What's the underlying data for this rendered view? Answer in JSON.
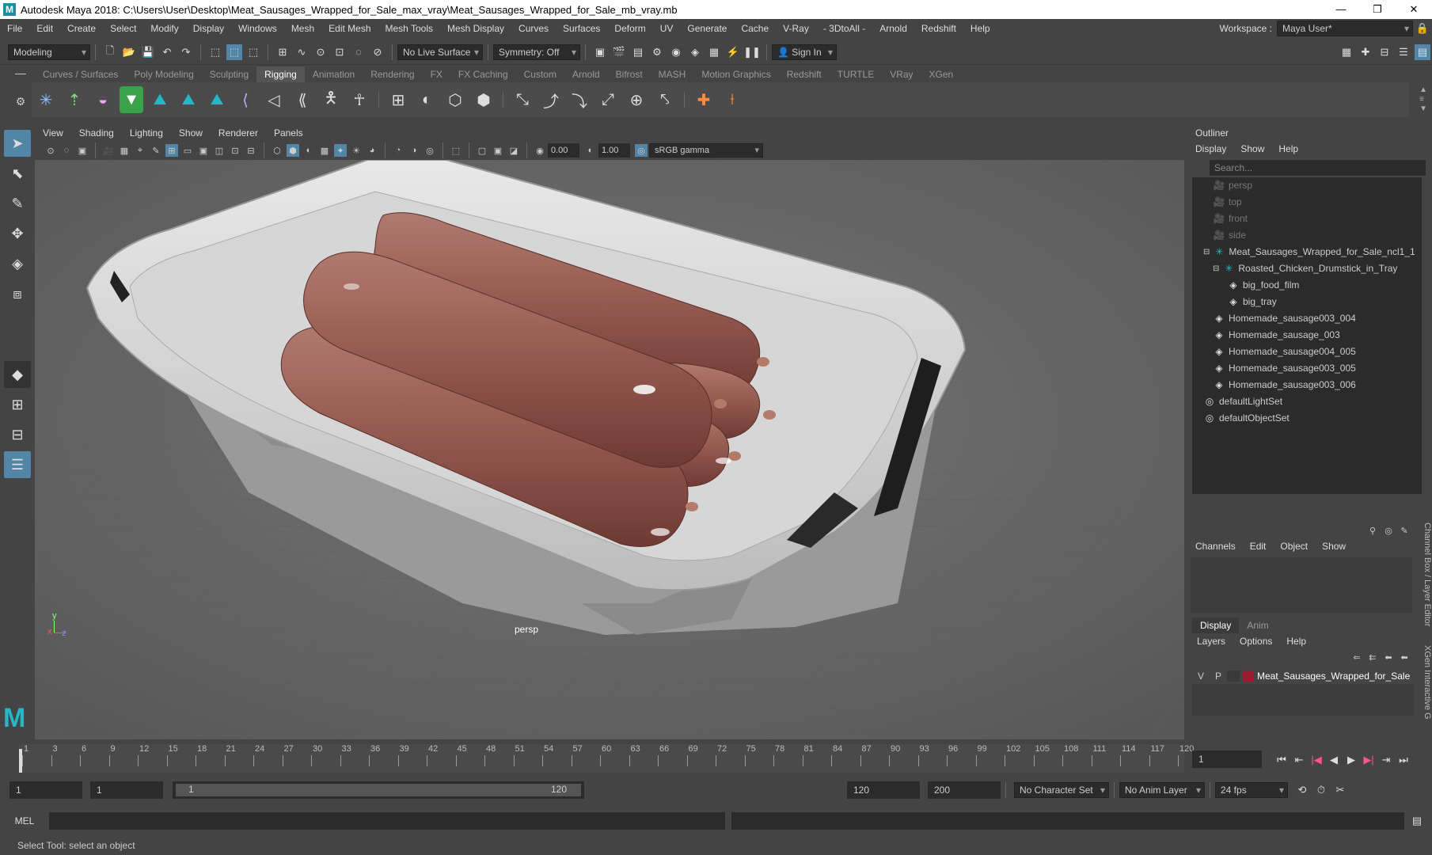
{
  "window": {
    "title": "Autodesk Maya 2018: C:\\Users\\User\\Desktop\\Meat_Sausages_Wrapped_for_Sale_max_vray\\Meat_Sausages_Wrapped_for_Sale_mb_vray.mb",
    "logo": "M"
  },
  "menubar": {
    "items": [
      "File",
      "Edit",
      "Create",
      "Select",
      "Modify",
      "Display",
      "Windows",
      "Mesh",
      "Edit Mesh",
      "Mesh Tools",
      "Mesh Display",
      "Curves",
      "Surfaces",
      "Deform",
      "UV",
      "Generate",
      "Cache",
      "V-Ray",
      "- 3DtoAll -",
      "Arnold",
      "Redshift",
      "Help"
    ],
    "workspace_label": "Workspace :",
    "workspace_value": "Maya User*"
  },
  "statusline": {
    "mode": "Modeling",
    "live_surface": "No Live Surface",
    "symmetry": "Symmetry: Off",
    "sign_in": "Sign In"
  },
  "shelf": {
    "tabs": [
      "Curves / Surfaces",
      "Poly Modeling",
      "Sculpting",
      "Rigging",
      "Animation",
      "Rendering",
      "FX",
      "FX Caching",
      "Custom",
      "Arnold",
      "Bifrost",
      "MASH",
      "Motion Graphics",
      "Redshift",
      "TURTLE",
      "VRay",
      "XGen"
    ],
    "active_tab": "Rigging"
  },
  "viewport": {
    "menu": [
      "View",
      "Shading",
      "Lighting",
      "Show",
      "Renderer",
      "Panels"
    ],
    "exposure": "0.00",
    "gamma": "1.00",
    "color_space": "sRGB gamma",
    "camera_label": "persp",
    "axis_x": "x",
    "axis_y": "y",
    "axis_z": "z"
  },
  "outliner": {
    "title": "Outliner",
    "menu": [
      "Display",
      "Show",
      "Help"
    ],
    "search_placeholder": "Search...",
    "items": [
      {
        "label": "persp",
        "dim": true
      },
      {
        "label": "top",
        "dim": true
      },
      {
        "label": "front",
        "dim": true
      },
      {
        "label": "side",
        "dim": true
      },
      {
        "label": "Meat_Sausages_Wrapped_for_Sale_ncl1_1",
        "dim": false
      },
      {
        "label": "Roasted_Chicken_Drumstick_in_Tray",
        "dim": false
      },
      {
        "label": "big_food_film",
        "dim": false
      },
      {
        "label": "big_tray",
        "dim": false
      },
      {
        "label": "Homemade_sausage003_004",
        "dim": false
      },
      {
        "label": "Homemade_sausage_003",
        "dim": false
      },
      {
        "label": "Homemade_sausage004_005",
        "dim": false
      },
      {
        "label": "Homemade_sausage003_005",
        "dim": false
      },
      {
        "label": "Homemade_sausage003_006",
        "dim": false
      },
      {
        "label": "defaultLightSet",
        "dim": false
      },
      {
        "label": "defaultObjectSet",
        "dim": false
      }
    ]
  },
  "channelbox": {
    "menu": [
      "Channels",
      "Edit",
      "Object",
      "Show"
    ],
    "side_tab_1": "Channel Box / Layer Editor",
    "side_tab_2": "XGen Interactive G"
  },
  "layers": {
    "tabs": [
      "Display",
      "Anim"
    ],
    "menu": [
      "Layers",
      "Options",
      "Help"
    ],
    "layer": {
      "v": "V",
      "p": "P",
      "name": "Meat_Sausages_Wrapped_for_Sale",
      "color": "#9b1b2f"
    }
  },
  "timeline": {
    "ticks": [
      "1",
      "3",
      "6",
      "9",
      "12",
      "15",
      "18",
      "21",
      "24",
      "27",
      "30",
      "33",
      "36",
      "39",
      "42",
      "45",
      "48",
      "51",
      "54",
      "57",
      "60",
      "63",
      "66",
      "69",
      "72",
      "75",
      "78",
      "81",
      "84",
      "87",
      "90",
      "93",
      "96",
      "99",
      "102",
      "105",
      "108",
      "111",
      "114",
      "117",
      "120"
    ],
    "current_frame": "1"
  },
  "range": {
    "start": "1",
    "start2": "1",
    "slider_start": "1",
    "slider_end": "120",
    "end": "120",
    "end2": "200",
    "character_set": "No Character Set",
    "anim_layer": "No Anim Layer",
    "fps": "24 fps"
  },
  "cmdline": {
    "label": "MEL"
  },
  "helpline": {
    "text": "Select Tool: select an object"
  },
  "colors": {
    "accent": "#5285a6",
    "panel": "#444444",
    "viewport": "#676767"
  }
}
